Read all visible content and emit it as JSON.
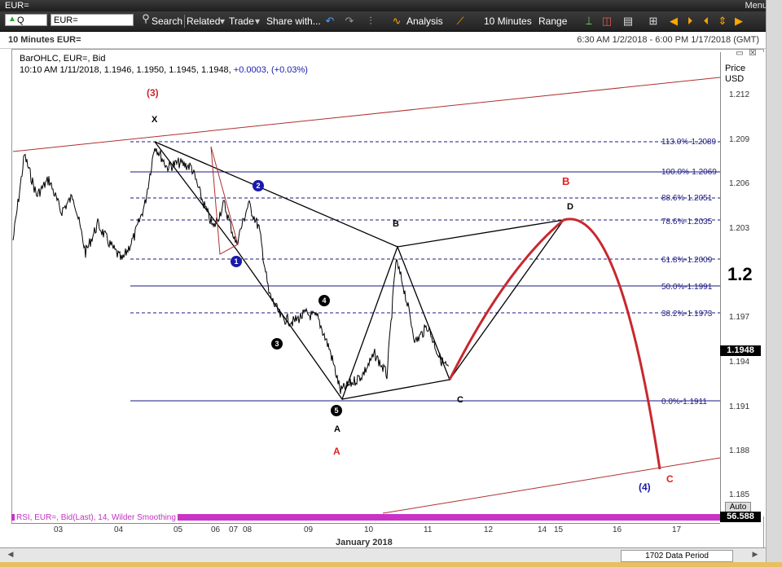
{
  "window": {
    "title": "EUR=",
    "menu_label": "Menu"
  },
  "toolbar": {
    "symbol_box": "Q",
    "ric_value": "EUR=",
    "search_label": "Search",
    "related_label": "Related",
    "trade_label": "Trade",
    "share_label": "Share with...",
    "analysis_label": "Analysis",
    "interval_label": "10 Minutes",
    "range_label": "Range"
  },
  "header": {
    "chart_title": "10 Minutes EUR=",
    "date_range": "6:30 AM 1/2/2018 - 6:00 PM 1/17/2018 (GMT)"
  },
  "legend": {
    "line1": "BarOHLC, EUR=, Bid",
    "line2_prefix": "10:10 AM 1/11/2018, 1.1946, 1.1950, 1.1945, 1.1948, ",
    "line2_change": "+0.0003, (+0.03%)"
  },
  "price_axis": {
    "header_line1": "Price",
    "header_line2": "USD",
    "ticks": [
      "1.212",
      "1.209",
      "1.206",
      "1.203",
      "1.197",
      "1.194",
      "1.191",
      "1.188",
      "1.185"
    ],
    "big_label": "1.2",
    "last_price": "1.1948"
  },
  "fib_levels": [
    {
      "label": "113.0%-1.2089"
    },
    {
      "label": "100.0%-1.2069"
    },
    {
      "label": "88.6%-1.2051"
    },
    {
      "label": "78.6%-1.2035"
    },
    {
      "label": "61.8%-1.2009"
    },
    {
      "label": "50.0%-1.1991"
    },
    {
      "label": "38.2%-1.1973"
    },
    {
      "label": "0.0%-1.1911"
    }
  ],
  "wave_labels": {
    "three_paren": "(3)",
    "four_paren": "(4)",
    "x": "X",
    "a_black": "A",
    "a_red": "A",
    "b_black": "B",
    "b_red": "B",
    "c_black": "C",
    "c_red": "C",
    "d_black": "D",
    "w1": "1",
    "w2": "2",
    "w3": "3",
    "w4": "4",
    "w5": "5"
  },
  "rsi": {
    "label": "RSI, EUR=, Bid(Last), 14, Wilder Smoothing",
    "value": "56.588",
    "auto_label": "Auto"
  },
  "x_axis": {
    "ticks": [
      "03",
      "04",
      "05",
      "06",
      "07",
      "08",
      "09",
      "10",
      "11",
      "12",
      "14",
      "15",
      "16",
      "17"
    ],
    "month_label": "January 2018"
  },
  "status": {
    "data_period": "1702 Data Period"
  },
  "colors": {
    "channel_line": "#b03030",
    "fib_line": "#1a1a80",
    "projection": "#c8282f",
    "rsi": "#c833c8",
    "wave_blue": "#1a1aaa"
  }
}
